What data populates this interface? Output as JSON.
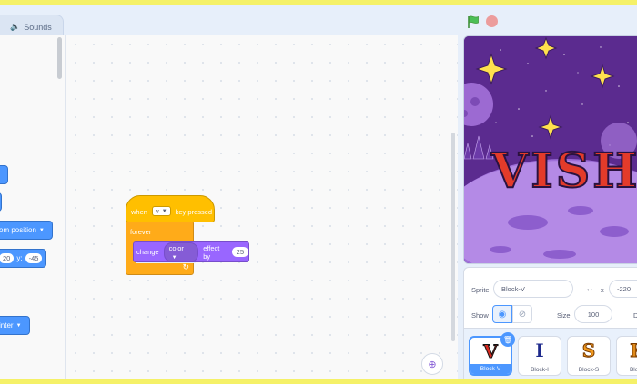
{
  "tabs": {
    "sounds_label": "Sounds",
    "sounds_icon": "speaker-icon"
  },
  "palette": {
    "blocks": [
      {
        "label": "om position",
        "has_caret": true
      },
      {
        "x_value": "20",
        "y_label": "y:",
        "y_value": "-45"
      },
      {
        "label": "inter",
        "has_caret": true
      }
    ]
  },
  "script": {
    "when_label": "when",
    "key_value": "v",
    "key_pressed_label": "key pressed",
    "forever_label": "forever",
    "change_label": "change",
    "effect_value": "color",
    "effect_by_label": "effect by",
    "amount_value": "25"
  },
  "stage": {
    "title_text": "VISH"
  },
  "sprite_info": {
    "sprite_label": "Sprite",
    "sprite_name": "Block-V",
    "x_label": "x",
    "x_value": "-220",
    "show_label": "Show",
    "size_label": "Size",
    "size_value": "100"
  },
  "sprites": [
    {
      "name": "Block-V",
      "glyph": "V",
      "color": "#d8281f",
      "selected": true
    },
    {
      "name": "Block-I",
      "glyph": "I",
      "color": "#1e2a8c"
    },
    {
      "name": "Block-S",
      "glyph": "S",
      "color": "#f29a1d"
    },
    {
      "name": "Block-",
      "glyph": "K",
      "color": "#e08a1a"
    }
  ],
  "colors": {
    "motion": "#4c97ff",
    "events": "#ffbf00",
    "control": "#ffab19",
    "looks": "#9966ff"
  }
}
